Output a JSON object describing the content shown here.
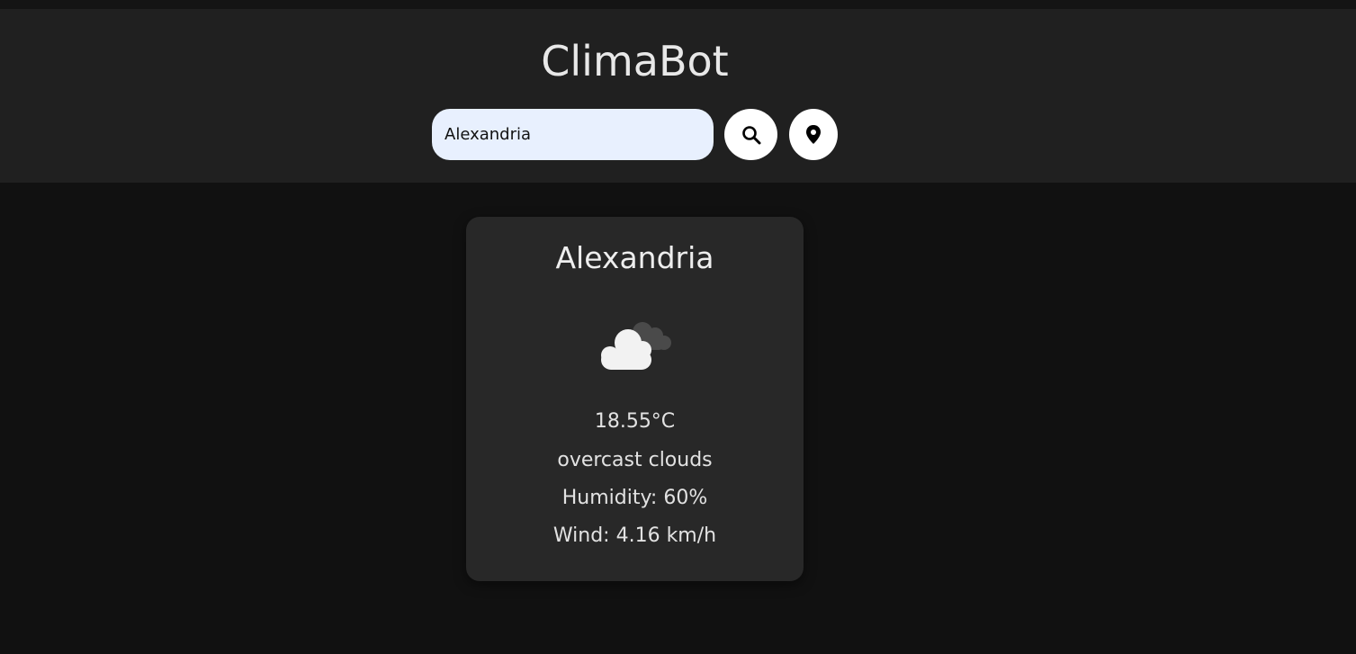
{
  "app": {
    "title": "ClimaBot"
  },
  "search": {
    "value": "Alexandria",
    "placeholder": ""
  },
  "icons": {
    "search": "search-icon",
    "location": "location-pin-icon",
    "weather": "overcast-clouds-icon"
  },
  "weather": {
    "city": "Alexandria",
    "temperature": "18.55°C",
    "description": "overcast clouds",
    "humidity": "Humidity: 60%",
    "wind": "Wind: 4.16 km/h"
  },
  "colors": {
    "background": "#111111",
    "header": "#202020",
    "card": "#282828",
    "input": "#e8f0fe",
    "button": "#ffffff"
  }
}
